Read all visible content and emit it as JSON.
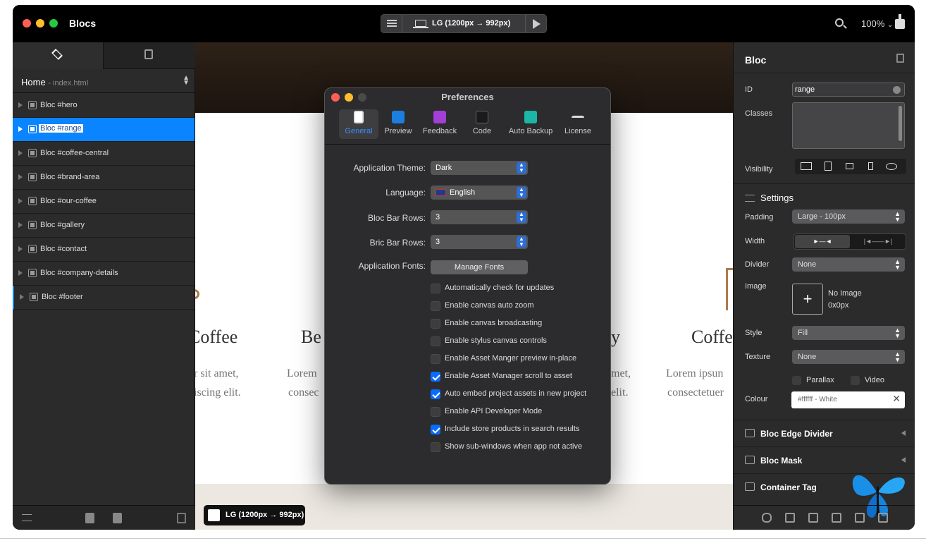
{
  "window": {
    "title": "Blocs",
    "device_label": "LG (1200px → 992px)",
    "zoom": "100%"
  },
  "left_panel": {
    "page_name": "Home",
    "page_file": "- index.html",
    "blocs": [
      {
        "label": "Bloc #hero",
        "selected": false
      },
      {
        "label": "Bloc #range",
        "selected": true
      },
      {
        "label": "Bloc #coffee-central",
        "selected": false
      },
      {
        "label": "Bloc #brand-area",
        "selected": false
      },
      {
        "label": "Bloc #our-coffee",
        "selected": false
      },
      {
        "label": "Bloc #gallery",
        "selected": false
      },
      {
        "label": "Bloc #contact",
        "selected": false
      },
      {
        "label": "Bloc #company-details",
        "selected": false
      },
      {
        "label": "Bloc #footer",
        "selected": false
      }
    ]
  },
  "canvas": {
    "col1_heading": "Coffee",
    "col1_text1": "r sit amet,",
    "col1_text2": "iscing elit.",
    "col2_heading": "Be",
    "col2_text1": "Lorem",
    "col2_text2": "consec",
    "col3_heading": "y",
    "col3_text1": "met,",
    "col3_text2": "elit.",
    "col4_heading": "Coffe",
    "col4_text1": "Lorem ipsun",
    "col4_text2": "consectetuer",
    "badge_label": "LG (1200px → 992px)"
  },
  "preferences": {
    "title": "Preferences",
    "tabs": [
      "General",
      "Preview",
      "Feedback",
      "Code",
      "Auto Backup",
      "License"
    ],
    "active_tab": "General",
    "fields": {
      "theme_label": "Application Theme:",
      "theme_value": "Dark",
      "language_label": "Language:",
      "language_value": "English",
      "bloc_rows_label": "Bloc Bar Rows:",
      "bloc_rows_value": "3",
      "bric_rows_label": "Bric Bar Rows:",
      "bric_rows_value": "3",
      "fonts_label": "Application Fonts:",
      "fonts_button": "Manage Fonts"
    },
    "checkboxes": [
      {
        "label": "Automatically check for updates",
        "checked": false
      },
      {
        "label": "Enable canvas auto zoom",
        "checked": false
      },
      {
        "label": "Enable canvas broadcasting",
        "checked": false
      },
      {
        "label": "Enable stylus canvas controls",
        "checked": false
      },
      {
        "label": "Enable Asset Manger preview in-place",
        "checked": false
      },
      {
        "label": "Enable Asset Manager scroll to asset",
        "checked": true
      },
      {
        "label": "Auto embed project assets in new project",
        "checked": true
      },
      {
        "label": "Enable API Developer Mode",
        "checked": false
      },
      {
        "label": "Include store products in search results",
        "checked": true
      },
      {
        "label": "Show sub-windows when app not active",
        "checked": false
      }
    ]
  },
  "right_panel": {
    "title": "Bloc",
    "id_label": "ID",
    "id_value": "range",
    "classes_label": "Classes",
    "visibility_label": "Visibility",
    "settings_title": "Settings",
    "padding_label": "Padding",
    "padding_value": "Large - 100px",
    "width_label": "Width",
    "divider_label": "Divider",
    "divider_value": "None",
    "image_label": "Image",
    "image_status": "No Image",
    "image_size": "0x0px",
    "style_label": "Style",
    "style_value": "Fill",
    "texture_label": "Texture",
    "texture_value": "None",
    "parallax_label": "Parallax",
    "video_label": "Video",
    "colour_label": "Colour",
    "colour_value": "#ffffff - White",
    "sections": [
      "Bloc Edge Divider",
      "Bloc Mask",
      "Container Tag"
    ]
  }
}
